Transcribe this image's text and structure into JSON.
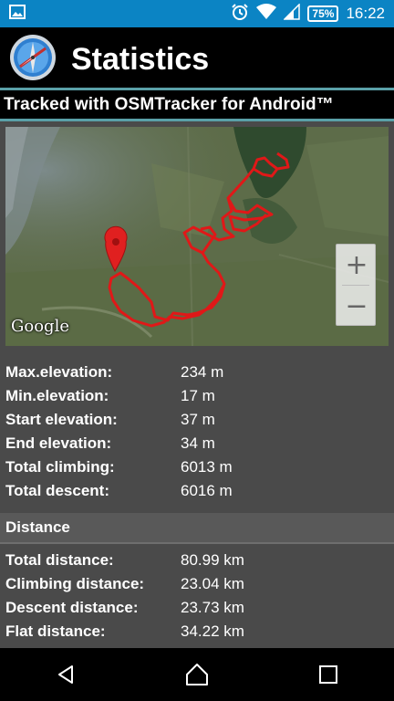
{
  "status_bar": {
    "battery": "75%",
    "time": "16:22"
  },
  "app_bar": {
    "title": "Statistics",
    "icon": "compass-icon"
  },
  "subtitle": "Tracked with OSMTracker for Android™",
  "map": {
    "attribution": "Google",
    "zoom_in": "+",
    "zoom_out": "−",
    "track_color": "#e01818",
    "marker_color": "#e02020"
  },
  "elevation_stats": [
    {
      "label": "Max.elevation:",
      "value": "234 m"
    },
    {
      "label": "Min.elevation:",
      "value": "17 m"
    },
    {
      "label": "Start elevation:",
      "value": "37 m"
    },
    {
      "label": "End elevation:",
      "value": "34 m"
    },
    {
      "label": "Total climbing:",
      "value": "6013 m"
    },
    {
      "label": "Total descent:",
      "value": "6016 m"
    }
  ],
  "distance_section": {
    "title": "Distance",
    "stats": [
      {
        "label": "Total distance:",
        "value": "80.99 km"
      },
      {
        "label": "Climbing distance:",
        "value": "23.04 km"
      },
      {
        "label": "Descent distance:",
        "value": "23.73 km"
      },
      {
        "label": "Flat distance:",
        "value": "34.22 km"
      }
    ]
  },
  "colors": {
    "status_bar": "#0b84c4",
    "accent_line": "#5aa0a8",
    "background": "#4a4a4a"
  }
}
